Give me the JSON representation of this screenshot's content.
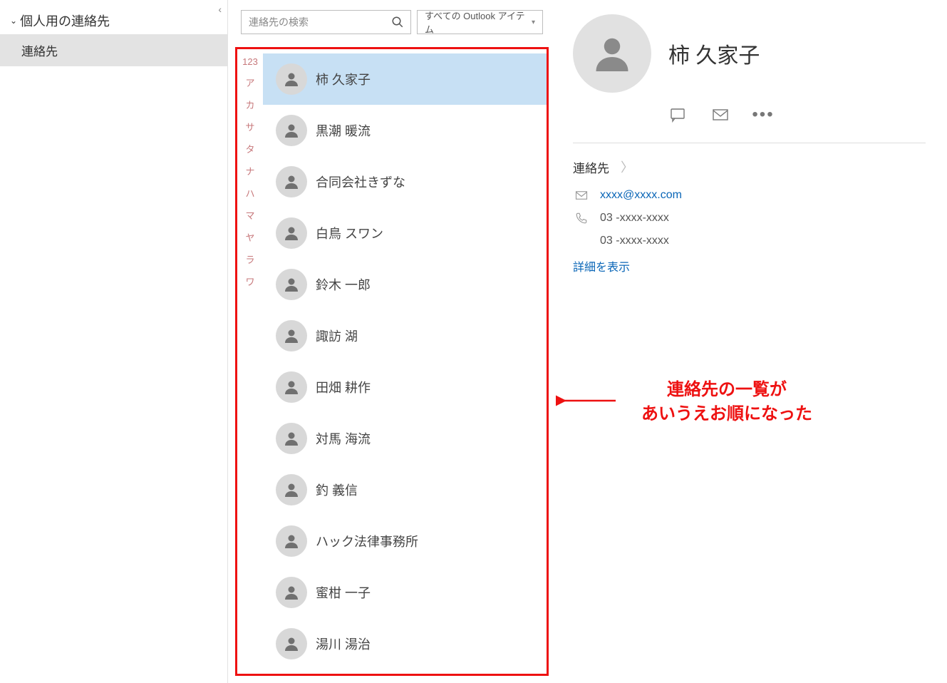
{
  "sidebar": {
    "group_header": "個人用の連絡先",
    "items": [
      {
        "label": "連絡先",
        "selected": true
      }
    ]
  },
  "search": {
    "placeholder": "連絡先の検索",
    "scope_label": "すべての Outlook アイテム"
  },
  "index_letters": [
    "123",
    "ア",
    "カ",
    "サ",
    "タ",
    "ナ",
    "ハ",
    "マ",
    "ヤ",
    "ラ",
    "ワ"
  ],
  "contacts": [
    {
      "name": "柿 久家子",
      "selected": true
    },
    {
      "name": "黒潮 暖流"
    },
    {
      "name": "合同会社きずな"
    },
    {
      "name": "白鳥 スワン"
    },
    {
      "name": "鈴木 一郎"
    },
    {
      "name": "諏訪 湖"
    },
    {
      "name": "田畑 耕作"
    },
    {
      "name": "対馬 海流"
    },
    {
      "name": "釣 義信"
    },
    {
      "name": "ハック法律事務所"
    },
    {
      "name": "蜜柑 一子"
    },
    {
      "name": "湯川 湯治"
    }
  ],
  "detail": {
    "name": "柿 久家子",
    "section_label": "連絡先",
    "email": "xxxx@xxxx.com",
    "phone1": "03 -xxxx-xxxx",
    "phone2": "03 -xxxx-xxxx",
    "show_more": "詳細を表示"
  },
  "annotation": {
    "line1": "連絡先の一覧が",
    "line2": "あいうえお順になった"
  }
}
